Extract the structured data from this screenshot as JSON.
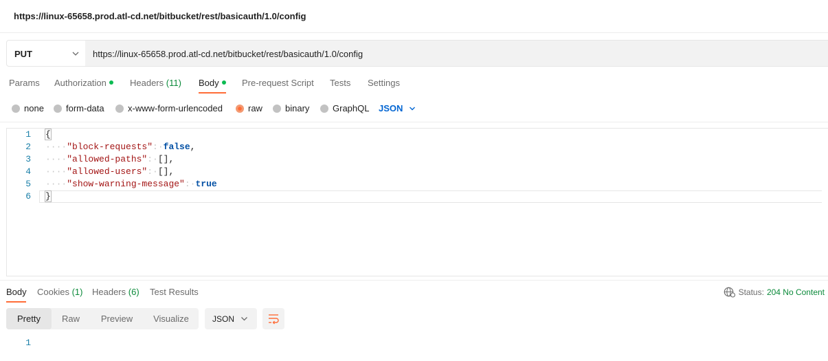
{
  "request": {
    "title": "https://linux-65658.prod.atl-cd.net/bitbucket/rest/basicauth/1.0/config",
    "method": "PUT",
    "url": "https://linux-65658.prod.atl-cd.net/bitbucket/rest/basicauth/1.0/config"
  },
  "request_tabs": {
    "params": "Params",
    "authorization": "Authorization",
    "headers": "Headers",
    "headers_count": "(11)",
    "body": "Body",
    "pre_request": "Pre-request Script",
    "tests": "Tests",
    "settings": "Settings",
    "active": "Body"
  },
  "body_types": {
    "none": "none",
    "form_data": "form-data",
    "urlencoded": "x-www-form-urlencoded",
    "raw": "raw",
    "binary": "binary",
    "graphql": "GraphQL",
    "selected": "raw",
    "language": "JSON"
  },
  "editor": {
    "line_numbers": [
      "1",
      "2",
      "3",
      "4",
      "5",
      "6"
    ],
    "lines": [
      {
        "indent": "",
        "key": "",
        "sep": "",
        "value": "",
        "punct": "{"
      },
      {
        "indent": "····",
        "key": "\"block-requests\"",
        "sep": ":·",
        "value": "false",
        "punct": ","
      },
      {
        "indent": "····",
        "key": "\"allowed-paths\"",
        "sep": ":·",
        "value": "",
        "punct": "[],"
      },
      {
        "indent": "····",
        "key": "\"allowed-users\"",
        "sep": ":·",
        "value": "",
        "punct": "[],"
      },
      {
        "indent": "····",
        "key": "\"show-warning-message\"",
        "sep": ":·",
        "value": "true",
        "punct": ""
      },
      {
        "indent": "",
        "key": "",
        "sep": "",
        "value": "",
        "punct": "}"
      }
    ]
  },
  "response_tabs": {
    "body": "Body",
    "cookies": "Cookies",
    "cookies_count": "(1)",
    "headers": "Headers",
    "headers_count": "(6)",
    "test_results": "Test Results",
    "active": "Body"
  },
  "response_status": {
    "label": "Status:",
    "value": "204 No Content"
  },
  "response_view": {
    "pretty": "Pretty",
    "raw": "Raw",
    "preview": "Preview",
    "visualize": "Visualize",
    "active": "Pretty",
    "format": "JSON"
  },
  "response_body": {
    "line_numbers": [
      "1"
    ]
  },
  "colors": {
    "accent": "#ff6c37",
    "status_green": "#0b8a3a",
    "dot_green": "#0cbb52",
    "link_blue": "#0265d2"
  },
  "icons": {
    "method_dropdown": "chevron-down-icon",
    "language_dropdown": "chevron-down-icon",
    "network": "globe-icon",
    "format_dropdown": "chevron-down-icon",
    "wrap": "wrap-lines-icon"
  }
}
